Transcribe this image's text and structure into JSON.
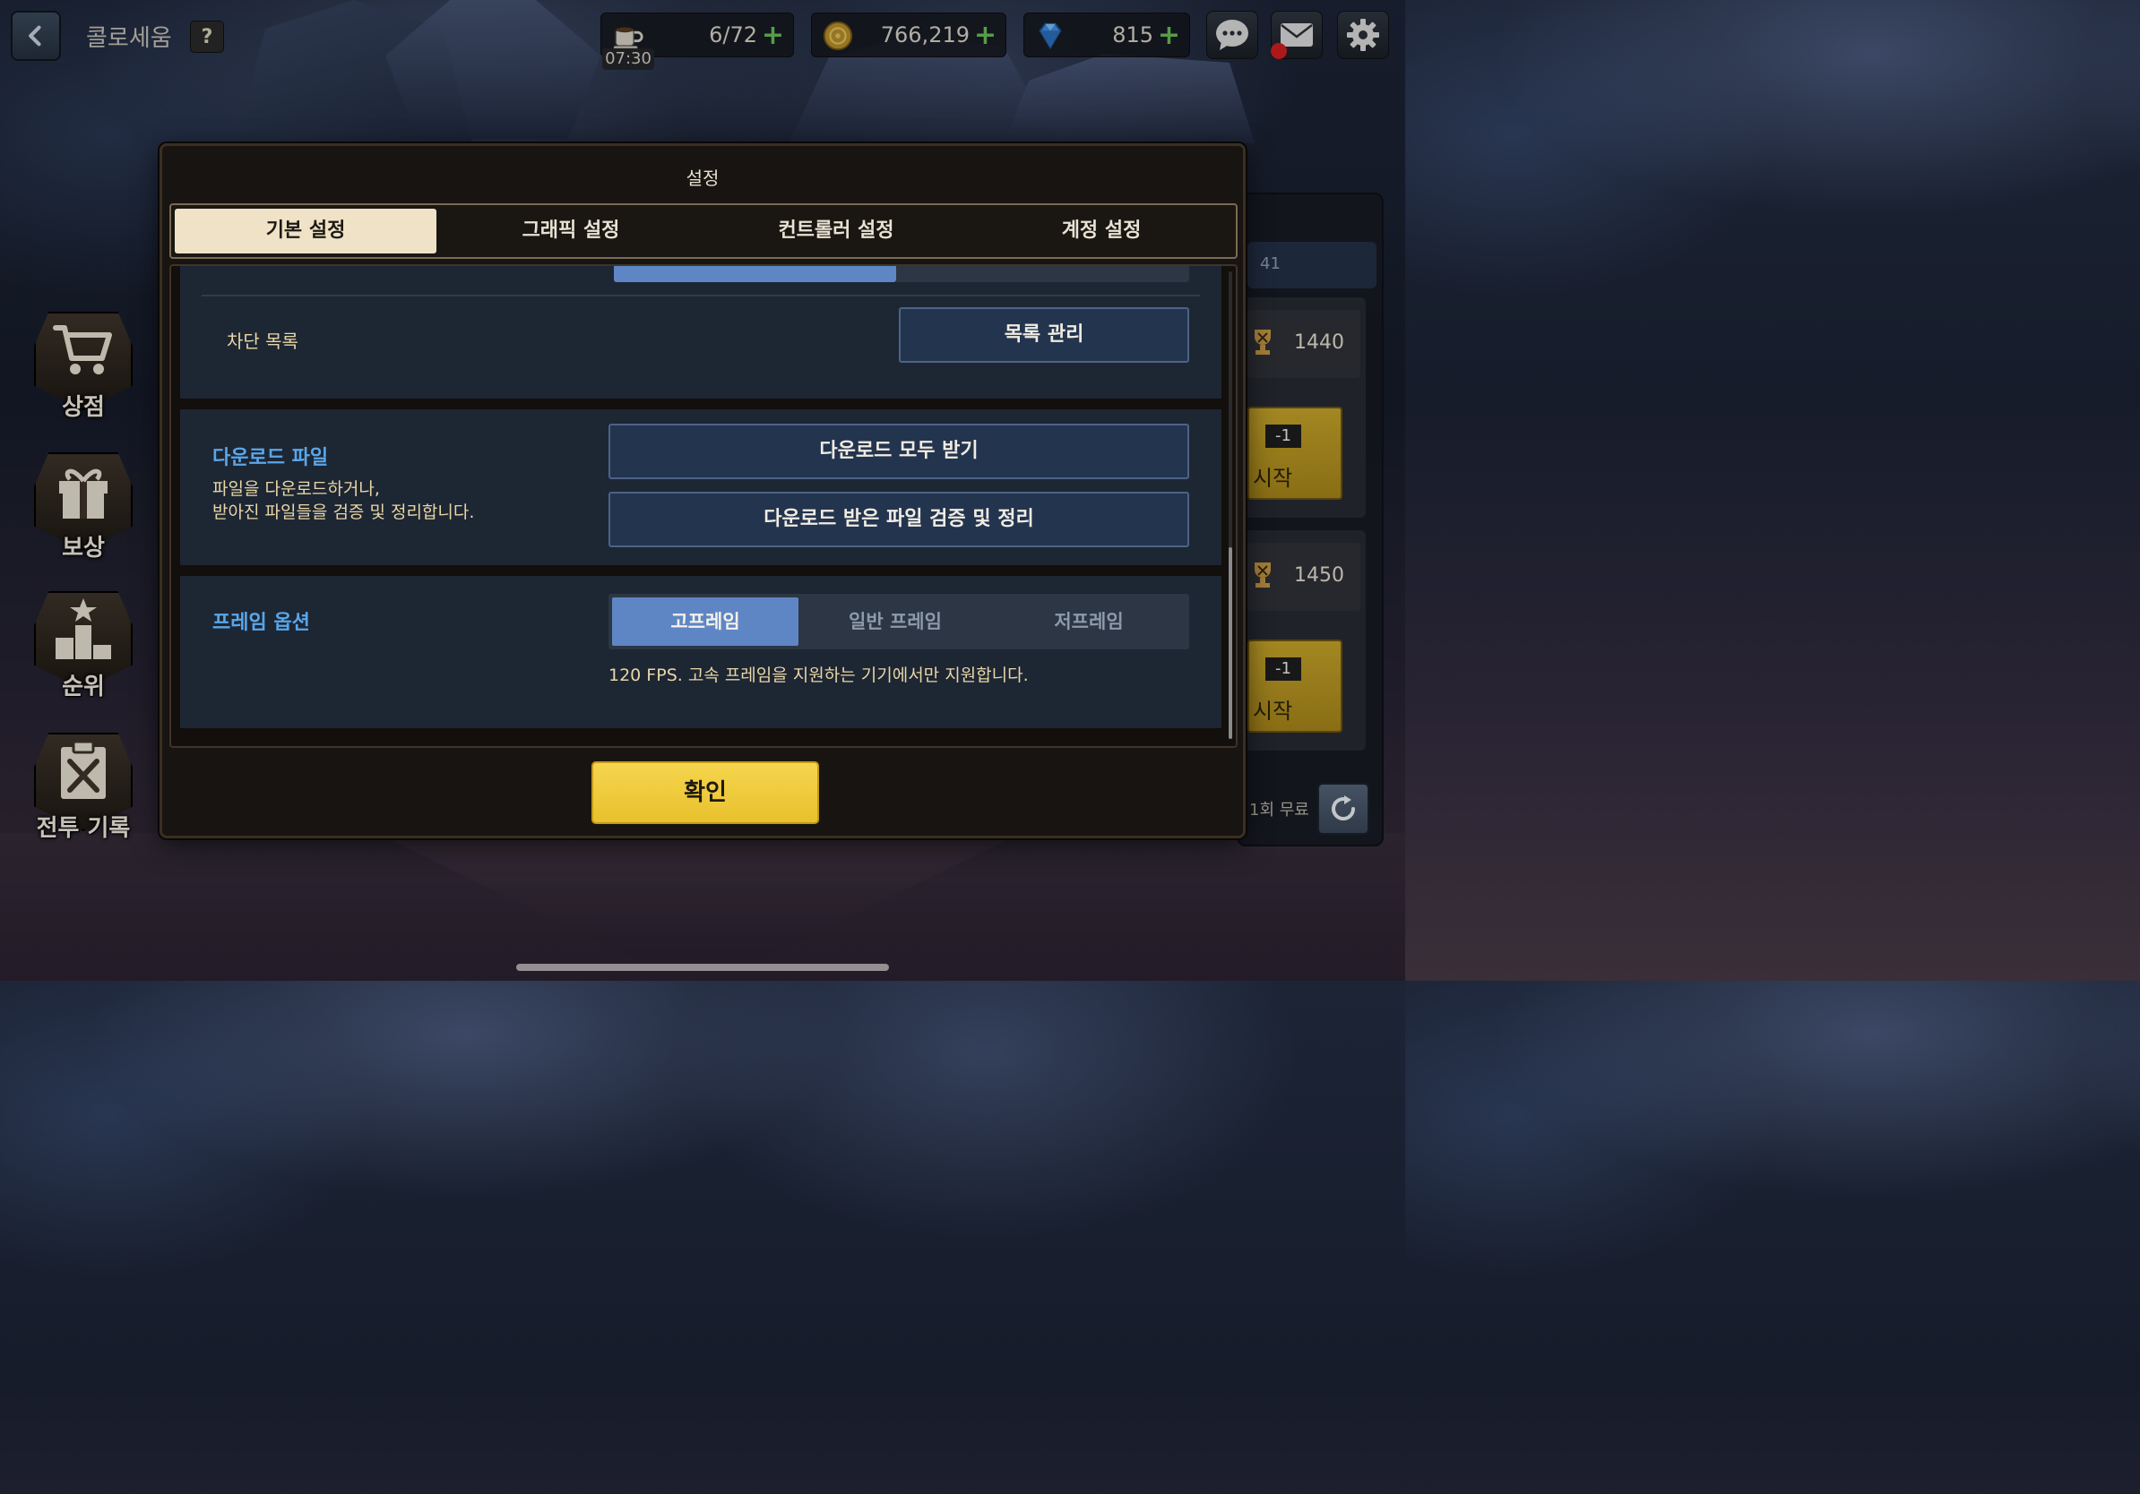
{
  "header": {
    "page_name": "콜로세움",
    "help_label": "?",
    "stamina": {
      "value": "6/72",
      "timer": "07:30"
    },
    "gold": {
      "value": "766,219"
    },
    "gems": {
      "value": "815"
    },
    "plus_label": "+"
  },
  "side_menu": [
    {
      "label": "상점"
    },
    {
      "label": "보상"
    },
    {
      "label": "순위"
    },
    {
      "label": "전투 기록"
    }
  ],
  "right_panel": {
    "header_value": "41",
    "matches": [
      {
        "score": "1440",
        "cost": "-1",
        "start_label": "시작"
      },
      {
        "score": "1450",
        "cost": "-1",
        "start_label": "시작"
      }
    ],
    "free_label": "1회 무료"
  },
  "dialog": {
    "title": "설정",
    "tabs": [
      {
        "label": "기본 설정",
        "active": true
      },
      {
        "label": "그래픽 설정",
        "active": false
      },
      {
        "label": "컨트롤러 설정",
        "active": false
      },
      {
        "label": "계정 설정",
        "active": false
      }
    ],
    "block_list": {
      "label": "차단 목록",
      "button": "목록 관리"
    },
    "previous_slider_fraction": 0.49,
    "download": {
      "title": "다운로드 파일",
      "desc_line1": "파일을 다운로드하거나,",
      "desc_line2": "받아진 파일들을 검증 및 정리합니다.",
      "btn_all": "다운로드 모두 받기",
      "btn_verify": "다운로드 받은 파일 검증 및 정리"
    },
    "frame": {
      "title": "프레임 옵션",
      "options": [
        "고프레임",
        "일반 프레임",
        "저프레임"
      ],
      "selected_index": 0,
      "note": "120 FPS. 고속 프레임을 지원하는 기기에서만 지원합니다."
    },
    "confirm_label": "확인"
  },
  "colors": {
    "accent_blue": "#5f86c4",
    "title_blue": "#59a6ea",
    "confirm_yellow": "#f6d64f",
    "label_cream": "#e9d6a6"
  }
}
